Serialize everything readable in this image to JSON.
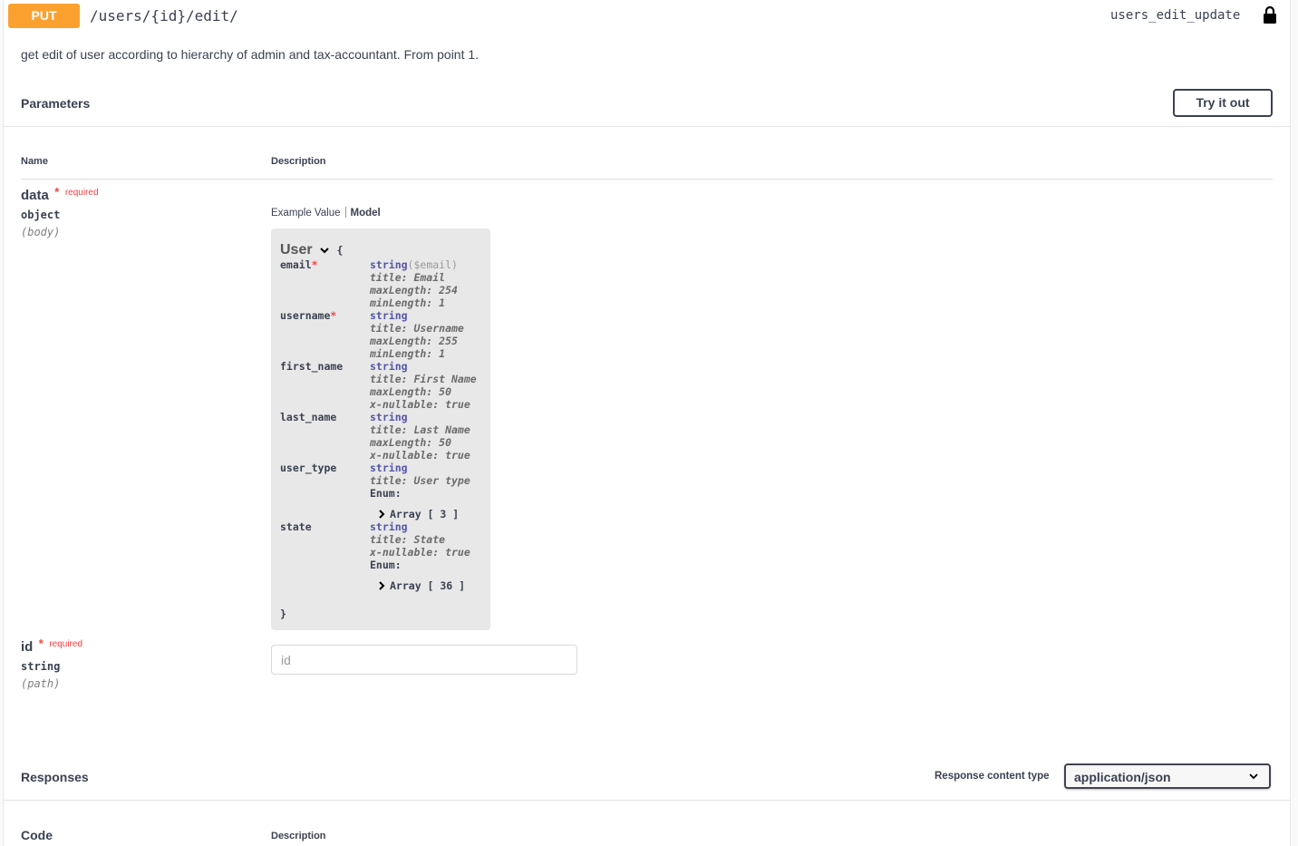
{
  "operation": {
    "method": "PUT",
    "path": "/users/{id}/edit/",
    "operation_id": "users_edit_update",
    "summary": "get edit of user according to hierarchy of admin and tax-accountant. From point 1.",
    "icons": {
      "lock": "lock-icon"
    }
  },
  "parameters": {
    "heading": "Parameters",
    "try_button": "Try it out",
    "col_name": "Name",
    "col_description": "Description",
    "items": [
      {
        "name": "data",
        "required_star": "*",
        "required_label": "required",
        "type": "object",
        "in": "(body)"
      },
      {
        "name": "id",
        "required_star": "*",
        "required_label": "required",
        "type": "string",
        "in": "(path)",
        "placeholder": "id"
      }
    ],
    "tabs": {
      "example": "Example Value",
      "model": "Model"
    }
  },
  "model": {
    "name": "User",
    "open_brace": "{",
    "close_brace": "}",
    "properties": [
      {
        "name": "email",
        "required": "*",
        "type": "string",
        "format": "($email)",
        "meta": [
          "title: Email",
          "maxLength: 254",
          "minLength: 1"
        ]
      },
      {
        "name": "username",
        "required": "*",
        "type": "string",
        "meta": [
          "title: Username",
          "maxLength: 255",
          "minLength: 1"
        ]
      },
      {
        "name": "first_name",
        "type": "string",
        "meta": [
          "title: First Name",
          "maxLength: 50",
          "x-nullable: true"
        ]
      },
      {
        "name": "last_name",
        "type": "string",
        "meta": [
          "title: Last Name",
          "maxLength: 50",
          "x-nullable: true"
        ]
      },
      {
        "name": "user_type",
        "type": "string",
        "meta": [
          "title: User type"
        ],
        "enum_label": "Enum:",
        "enum_array": "Array [ 3 ]"
      },
      {
        "name": "state",
        "type": "string",
        "meta": [
          "title: State",
          "x-nullable: true"
        ],
        "enum_label": "Enum:",
        "enum_array": "Array [ 36 ]"
      }
    ]
  },
  "responses": {
    "heading": "Responses",
    "content_type_label": "Response content type",
    "content_type_value": "application/json",
    "col_code": "Code",
    "col_description": "Description"
  }
}
